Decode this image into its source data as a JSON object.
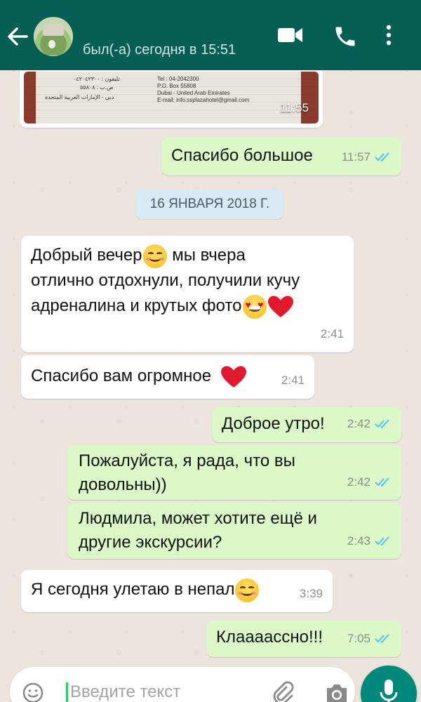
{
  "header": {
    "contact_status": "был(-а) сегодня в 15:51",
    "icons": {
      "back": "arrow-back-icon",
      "video": "videocam-icon",
      "call": "phone-icon",
      "menu": "more-vert-icon"
    }
  },
  "image_message": {
    "time": "11:55",
    "card_lines": [
      "Tel : 04-2042300",
      "P.O. Box 55808",
      "Dubai - United Arab Emirates",
      "E-mail: info.ssplazahotel@gmail.com"
    ],
    "card_lines_ar": [
      "تليفون : ٠٤٢٠٤٢٣٠٠",
      "ص.ب : ٥٥٨٠٨",
      "دبي - الإمارات العربية المتحدة"
    ]
  },
  "date_separator": "16 ЯНВАРЯ 2018 Г.",
  "messages": [
    {
      "id": "m1",
      "dir": "out",
      "text": "Спасибо большое",
      "time": "11:57",
      "read": true
    },
    {
      "id": "m2",
      "dir": "in",
      "lines": [
        "Добрый вечер",
        " мы вчера",
        "отлично отдохнули, получили кучу",
        "адреналина и крутых фото"
      ],
      "time": "2:41"
    },
    {
      "id": "m3",
      "dir": "in",
      "text": "Спасибо вам огромное",
      "time": "2:41"
    },
    {
      "id": "m4",
      "dir": "out",
      "text": "Доброе утро!",
      "time": "2:42",
      "read": true
    },
    {
      "id": "m5",
      "dir": "out",
      "lines": [
        "Пожалуйста, я рада, что вы",
        "довольны))"
      ],
      "time": "2:42",
      "read": true
    },
    {
      "id": "m6",
      "dir": "out",
      "lines": [
        "Людмила, может хотите ещё и",
        "другие экскурсии?"
      ],
      "time": "2:43",
      "read": true
    },
    {
      "id": "m7",
      "dir": "in",
      "text": "Я сегодня улетаю в непал",
      "time": "3:39"
    },
    {
      "id": "m8",
      "dir": "out",
      "text": "Клаааассно!!!",
      "time": "7:05",
      "read": true
    }
  ],
  "composer": {
    "placeholder": "Введите текст",
    "icons": {
      "emoji": "smiley-icon",
      "attach": "paperclip-icon",
      "camera": "camera-icon",
      "mic": "mic-icon"
    }
  },
  "colors": {
    "appbar": "#075e54",
    "outgoing_bubble": "#dcf8c6",
    "incoming_bubble": "#ffffff",
    "read_ticks": "#4fc3f7",
    "mic_button": "#00897b"
  }
}
